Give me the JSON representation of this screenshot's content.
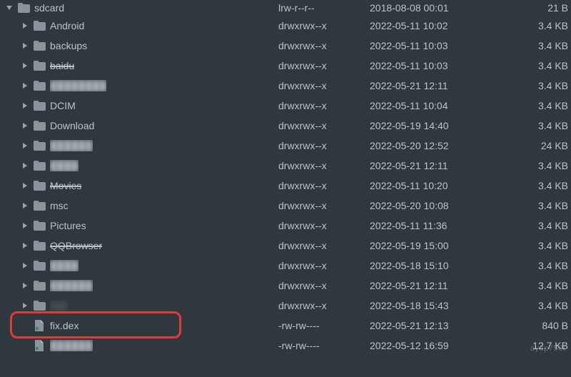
{
  "colors": {
    "bg": "#30383f",
    "fg": "#bac3cb",
    "highlight": "#e03b3b"
  },
  "root": {
    "name": "sdcard",
    "perm": "lrw-r--r--",
    "date": "2018-08-08 00:01",
    "size": "21 B",
    "expanded": true,
    "kind": "folder"
  },
  "children": [
    {
      "name": "Android",
      "perm": "drwxrwx--x",
      "date": "2022-05-11 10:02",
      "size": "3.4 KB",
      "kind": "folder"
    },
    {
      "name": "backups",
      "perm": "drwxrwx--x",
      "date": "2022-05-11 10:03",
      "size": "3.4 KB",
      "kind": "folder"
    },
    {
      "name": "baidu",
      "perm": "drwxrwx--x",
      "date": "2022-05-11 10:03",
      "size": "3.4 KB",
      "kind": "folder",
      "strike": true
    },
    {
      "name": "████████",
      "perm": "drwxrwx--x",
      "date": "2022-05-21 12:11",
      "size": "3.4 KB",
      "kind": "folder",
      "blur": true
    },
    {
      "name": "DCIM",
      "perm": "drwxrwx--x",
      "date": "2022-05-11 10:04",
      "size": "3.4 KB",
      "kind": "folder"
    },
    {
      "name": "Download",
      "perm": "drwxrwx--x",
      "date": "2022-05-19 14:40",
      "size": "3.4 KB",
      "kind": "folder"
    },
    {
      "name": "██████",
      "perm": "drwxrwx--x",
      "date": "2022-05-20 12:52",
      "size": "24 KB",
      "kind": "folder",
      "blur": true
    },
    {
      "name": "████",
      "perm": "drwxrwx--x",
      "date": "2022-05-21 12:11",
      "size": "3.4 KB",
      "kind": "folder",
      "blur": true
    },
    {
      "name": "Movies",
      "perm": "drwxrwx--x",
      "date": "2022-05-11 10:20",
      "size": "3.4 KB",
      "kind": "folder",
      "strike": true
    },
    {
      "name": "msc",
      "perm": "drwxrwx--x",
      "date": "2022-05-20 10:08",
      "size": "3.4 KB",
      "kind": "folder"
    },
    {
      "name": "Pictures",
      "perm": "drwxrwx--x",
      "date": "2022-05-11 11:36",
      "size": "3.4 KB",
      "kind": "folder"
    },
    {
      "name": "QQBrowser",
      "perm": "drwxrwx--x",
      "date": "2022-05-19 15:00",
      "size": "3.4 KB",
      "kind": "folder",
      "strike": true
    },
    {
      "name": "████",
      "perm": "drwxrwx--x",
      "date": "2022-05-18 15:10",
      "size": "3.4 KB",
      "kind": "folder",
      "blur": true
    },
    {
      "name": "██████",
      "perm": "drwxrwx--x",
      "date": "2022-05-21 12:11",
      "size": "3.4 KB",
      "kind": "folder",
      "blur": true
    },
    {
      "name": "□□□",
      "perm": "drwxrwx--x",
      "date": "2022-05-18 15:43",
      "size": "3.4 KB",
      "kind": "folder",
      "blur": true
    },
    {
      "name": "fix.dex",
      "perm": "-rw-rw----",
      "date": "2022-05-21 12:13",
      "size": "840 B",
      "kind": "file",
      "highlight": true
    },
    {
      "name": "██████",
      "perm": "-rw-rw----",
      "date": "2022-05-12 16:59",
      "size": "12.7 KB",
      "kind": "file",
      "blur": true
    }
  ],
  "watermark": "ay3p750t"
}
